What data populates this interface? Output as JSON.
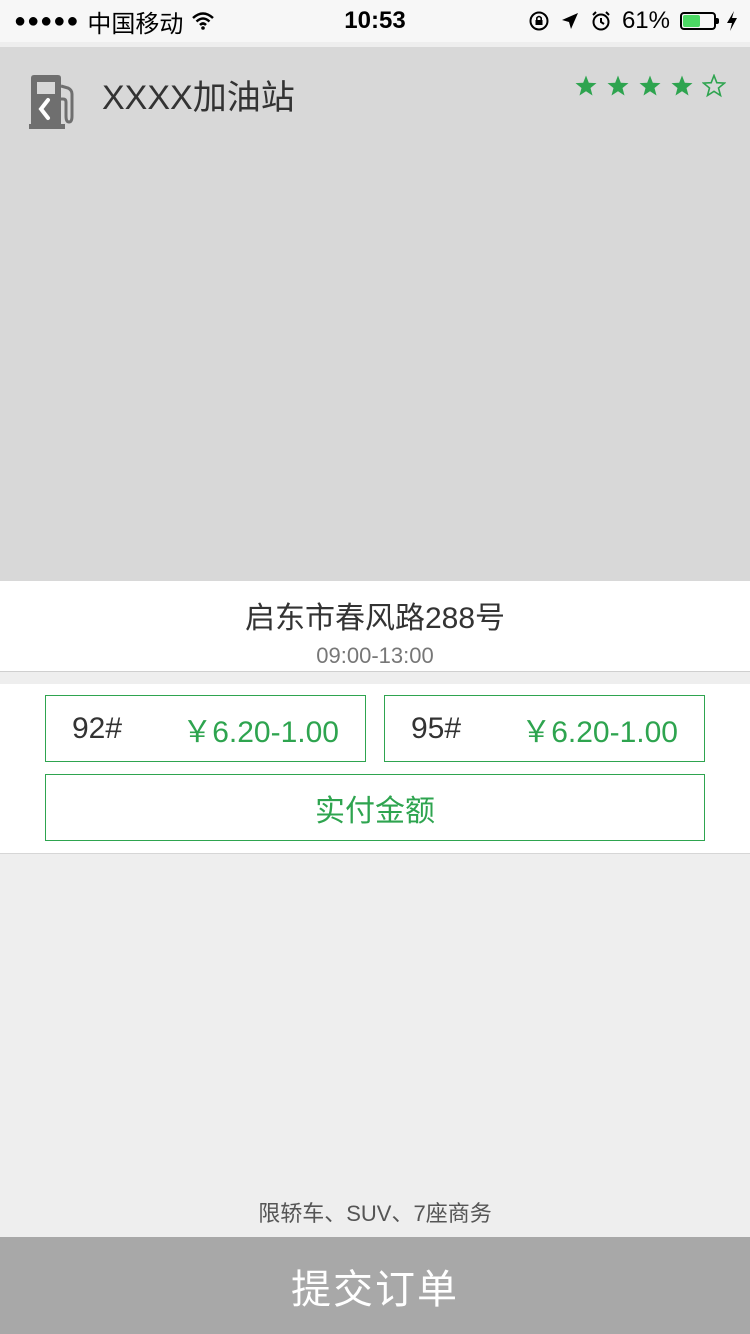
{
  "status_bar": {
    "signal": "●●●●●",
    "carrier": "中国移动",
    "time": "10:53",
    "battery_percent": "61%",
    "battery_level": 0.61
  },
  "header": {
    "station_name": "XXXX加油站",
    "rating": 4.5,
    "accent_color": "#2ea44f"
  },
  "station": {
    "address": "启东市春风路288号",
    "hours": "09:00-13:00"
  },
  "fuel_options": [
    {
      "grade": "92#",
      "price": "￥6.20-1.00"
    },
    {
      "grade": "95#",
      "price": "￥6.20-1.00"
    }
  ],
  "pay_label": "实付金额",
  "restriction": "限轿车、SUV、7座商务",
  "submit_label": "提交订单"
}
